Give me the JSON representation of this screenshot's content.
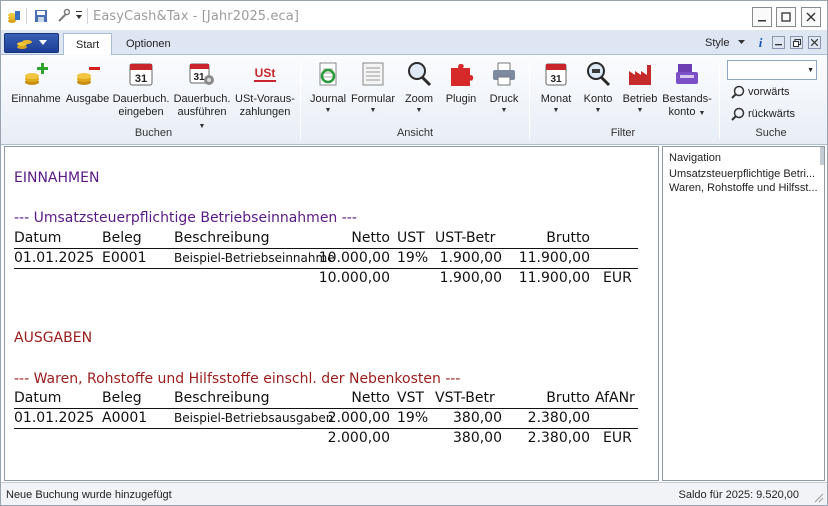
{
  "window": {
    "title": "EasyCash&Tax - [Jahr2025.eca]"
  },
  "tabs": [
    {
      "label": "Start",
      "active": true
    },
    {
      "label": "Optionen",
      "active": false
    }
  ],
  "style_label": "Style",
  "ribbon": {
    "groups": {
      "buchen": "Buchen",
      "ansicht": "Ansicht",
      "filter": "Filter",
      "suche": "Suche"
    },
    "buttons": {
      "einnahme": "Einnahme",
      "ausgabe": "Ausgabe",
      "dauer_eingeben_1": "Dauerbuch.",
      "dauer_eingeben_2": "eingeben",
      "dauer_ausfuehren_1": "Dauerbuch.",
      "dauer_ausfuehren_2": "ausführen",
      "ust_1": "USt-Voraus-",
      "ust_2": "zahlungen",
      "journal": "Journal",
      "formular": "Formular",
      "zoom": "Zoom",
      "plugin": "Plugin",
      "druck": "Druck",
      "monat": "Monat",
      "konto": "Konto",
      "betrieb": "Betrieb",
      "bestandskonto_1": "Bestands-",
      "bestandskonto_2": "konto",
      "vorwaerts": "vorwärts",
      "rueckwaerts": "rückwärts"
    },
    "icon_text": {
      "calendar_day": "31",
      "ust_icon": "USt"
    }
  },
  "document": {
    "einnahmen_heading": "EINNAHMEN",
    "einnahmen_section": "--- Umsatzsteuerpflichtige Betriebseinnahmen ---",
    "einnahmen_headers": [
      "Datum",
      "Beleg",
      "Beschreibung",
      "Netto",
      "UST",
      "UST-Betr",
      "Brutto"
    ],
    "einnahmen_row": [
      "01.01.2025",
      "E0001",
      "Beispiel-Betriebseinnahme",
      "10.000,00",
      "19%",
      "1.900,00",
      "11.900,00"
    ],
    "einnahmen_totals": [
      "10.000,00",
      "1.900,00",
      "11.900,00",
      "EUR"
    ],
    "ausgaben_heading": "AUSGABEN",
    "ausgaben_section": "--- Waren, Rohstoffe und Hilfsstoffe einschl. der Nebenkosten ---",
    "ausgaben_headers": [
      "Datum",
      "Beleg",
      "Beschreibung",
      "Netto",
      "VST",
      "VST-Betr",
      "Brutto",
      "AfANr"
    ],
    "ausgaben_row": [
      "01.01.2025",
      "A0001",
      "Beispiel-Betriebsausgaben",
      "2.000,00",
      "19%",
      "380,00",
      "2.380,00"
    ],
    "ausgaben_totals": [
      "2.000,00",
      "380,00",
      "2.380,00",
      "EUR"
    ]
  },
  "navigation": {
    "title": "Navigation",
    "items": [
      "Umsatzsteuerpflichtige Betri...",
      "Waren, Rohstoffe und Hilfsst..."
    ]
  },
  "status": {
    "left": "Neue Buchung wurde hinzugefügt",
    "right": "Saldo für 2025: 9.520,00"
  },
  "colors": {
    "einnahmen": "#5a1a86",
    "ausgaben": "#9b1c1c",
    "ribbon_tab_bg": "#dde6f2",
    "app_button": "#2a4ea6"
  }
}
